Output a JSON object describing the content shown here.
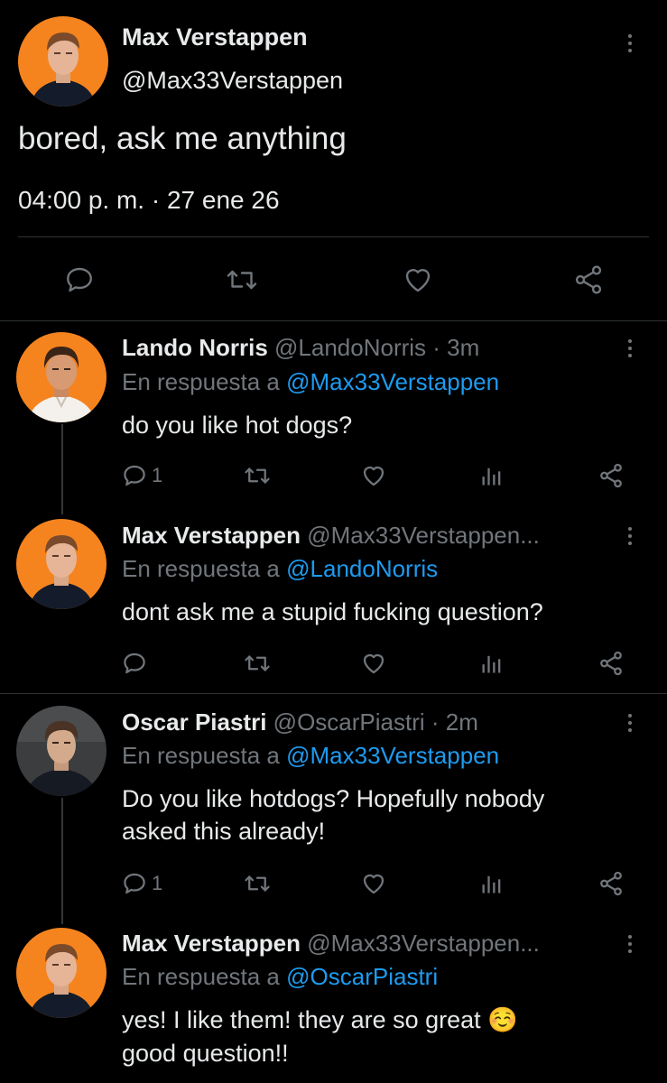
{
  "main_tweet": {
    "display_name": "Max Verstappen",
    "handle": "@Max33Verstappen",
    "text": "bored, ask me anything",
    "timestamp": "04:00 p. m. · 27 ene 26",
    "actions": [
      "reply-icon",
      "retweet-icon",
      "like-icon",
      "share-icon"
    ]
  },
  "replies": [
    {
      "display_name": "Lando Norris",
      "handle_meta": "@LandoNorris · 3m",
      "reply_prefix": "En respuesta a",
      "reply_to": "@Max33Verstappen",
      "text_lines": [
        "do you like hot dogs?"
      ],
      "reply_count": "1"
    },
    {
      "display_name": "Max Verstappen",
      "handle_meta": "@Max33Verstappen...",
      "reply_prefix": "En respuesta a",
      "reply_to": "@LandoNorris",
      "text_lines": [
        "dont ask me a stupid fucking question?"
      ],
      "reply_count": ""
    },
    {
      "display_name": "Oscar Piastri",
      "handle_meta": "@OscarPiastri · 2m",
      "reply_prefix": "En respuesta a",
      "reply_to": "@Max33Verstappen",
      "text_lines": [
        "Do you like hotdogs? Hopefully nobody",
        "asked this already!"
      ],
      "reply_count": "1"
    },
    {
      "display_name": "Max Verstappen",
      "handle_meta": "@Max33Verstappen...",
      "reply_prefix": "En respuesta a",
      "reply_to": "@OscarPiastri",
      "text_lines": [
        "yes! I like them! they are so great ☺️",
        "good question!!"
      ],
      "reply_count": ""
    }
  ],
  "colors": {
    "background": "#000000",
    "text": "#e7e9ea",
    "secondary": "#71767b",
    "link": "#1d9bf0",
    "divider": "#2f3336",
    "avatar_orange": "#f5841f"
  }
}
